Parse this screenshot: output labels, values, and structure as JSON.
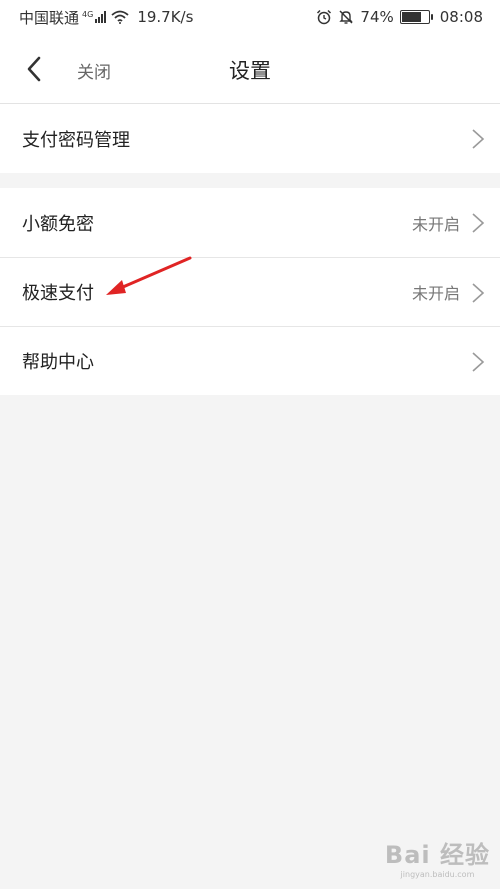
{
  "status_bar": {
    "carrier": "中国联通",
    "network": "4G",
    "speed": "19.7K/s",
    "battery": "74%",
    "battery_level": 0.74,
    "time": "08:08"
  },
  "nav": {
    "close_label": "关闭",
    "title": "设置"
  },
  "section1": [
    {
      "label": "支付密码管理"
    }
  ],
  "section2": [
    {
      "label": "小额免密",
      "value": "未开启"
    },
    {
      "label": "极速支付",
      "value": "未开启"
    },
    {
      "label": "帮助中心"
    }
  ],
  "annotation": {
    "color": "#e02424"
  },
  "watermark": {
    "logo": "Bai 经验",
    "url": "jingyan.baidu.com"
  }
}
